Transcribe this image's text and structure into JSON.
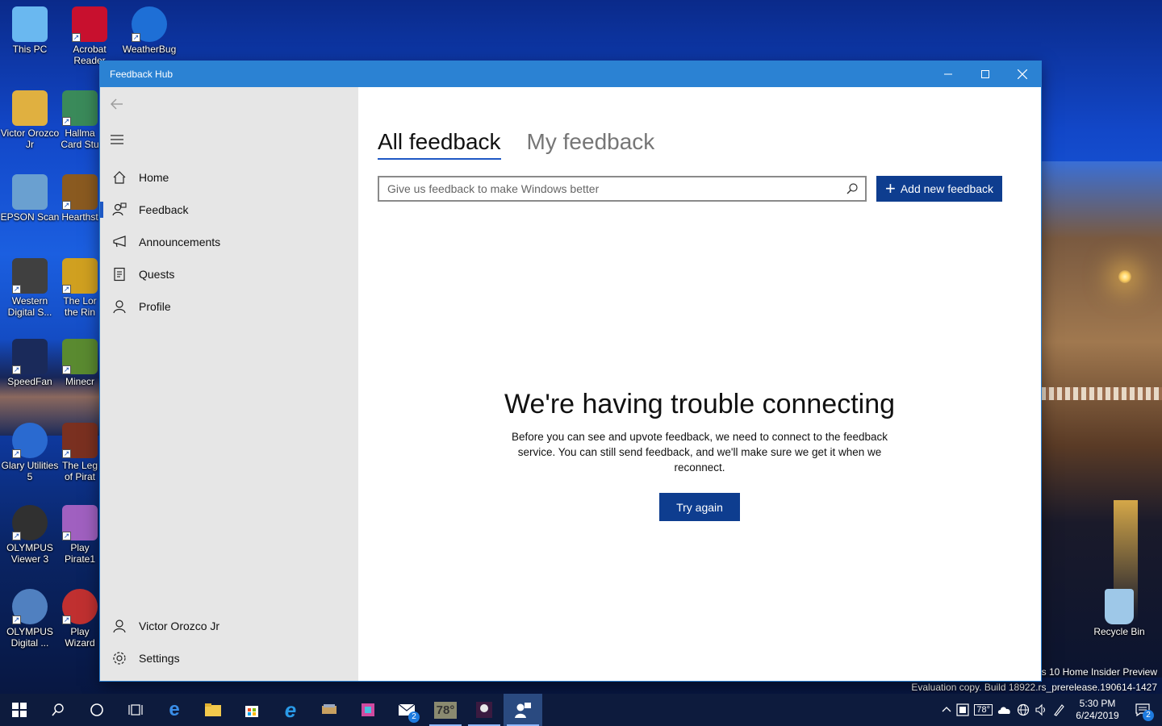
{
  "window": {
    "title": "Feedback Hub",
    "controls": [
      "minimize-icon",
      "maximize-icon",
      "close-icon"
    ]
  },
  "sidebar": {
    "items": [
      {
        "label": "Home",
        "icon": "home-icon"
      },
      {
        "label": "Feedback",
        "icon": "feedback-icon"
      },
      {
        "label": "Announcements",
        "icon": "megaphone-icon"
      },
      {
        "label": "Quests",
        "icon": "quests-icon"
      },
      {
        "label": "Profile",
        "icon": "person-icon"
      }
    ],
    "user": "Victor Orozco Jr",
    "settings": "Settings"
  },
  "main": {
    "tabs": [
      {
        "label": "All feedback",
        "active": true
      },
      {
        "label": "My feedback",
        "active": false
      }
    ],
    "search_placeholder": "Give us feedback to make Windows better",
    "add_button": "Add new feedback",
    "error_title": "We're having trouble connecting",
    "error_body": "Before you can see and upvote feedback, we need to connect to the feedback service. You can still send feedback, and we'll make sure we get it when we reconnect.",
    "retry_button": "Try again"
  },
  "desktop": {
    "icons": [
      {
        "label": "This PC",
        "color": "#6ab8f0"
      },
      {
        "label": "Acrobat Reader",
        "color": "#c8102e"
      },
      {
        "label": "WeatherBug",
        "color": "#1e6fd6"
      },
      {
        "label": "Victor Orozco Jr",
        "color": "#e0b040"
      },
      {
        "label": "Hallma Card Stu",
        "color": "#3a8a5a"
      },
      {
        "label": "EPSON Scan",
        "color": "#6aa0d0"
      },
      {
        "label": "Hearthst",
        "color": "#8a5a20"
      },
      {
        "label": "Western Digital S...",
        "color": "#404040"
      },
      {
        "label": "The Lor the Rin",
        "color": "#d0a020"
      },
      {
        "label": "SpeedFan",
        "color": "#1a2a5a"
      },
      {
        "label": "Minecr",
        "color": "#5a8a30"
      },
      {
        "label": "Glary Utilities 5",
        "color": "#2a6ad0"
      },
      {
        "label": "The Leg of Pirat",
        "color": "#7a3020"
      },
      {
        "label": "OLYMPUS Viewer 3",
        "color": "#303030"
      },
      {
        "label": "Play Pirate1",
        "color": "#a060c0"
      },
      {
        "label": "OLYMPUS Digital ...",
        "color": "#5080c0"
      },
      {
        "label": "Play Wizard",
        "color": "#c03030"
      },
      {
        "label": "Recycle Bin",
        "color": "#9ec8e8"
      }
    ],
    "watermark_line1": "ws 10 Home Insider Preview",
    "watermark_line2": "Evaluation copy. Build 18922.rs_prerelease.190614-1427"
  },
  "taskbar": {
    "items": [
      "start-icon",
      "search-icon",
      "cortana-icon",
      "task-view-icon",
      "edge-icon",
      "file-explorer-icon",
      "store-icon",
      "ie-icon",
      "app-icon",
      "photo-app-icon",
      "mail-icon",
      "weather-app-icon",
      "game-icon",
      "feedback-hub-icon"
    ],
    "mail_badge": "2",
    "weather_temp": "78°",
    "tray_temp": "78°",
    "time": "5:30 PM",
    "date": "6/24/2019",
    "notification_count": "2"
  }
}
